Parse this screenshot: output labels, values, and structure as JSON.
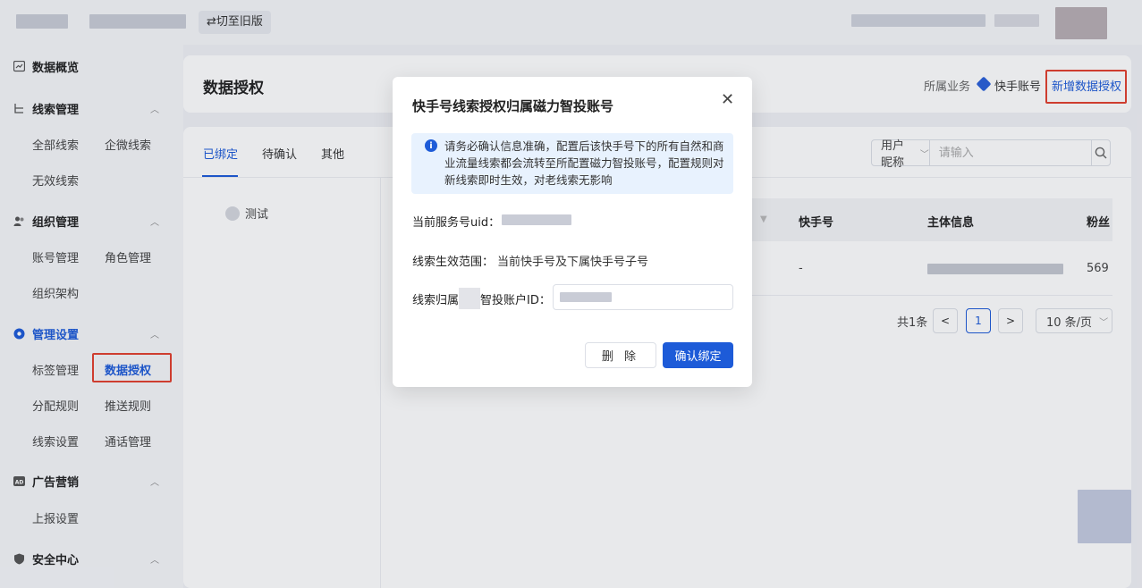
{
  "colors": {
    "accent": "#1d5bd8",
    "highlight": "#e2402e"
  },
  "topbar": {
    "switch_label": "⇄切至旧版"
  },
  "sidebar": {
    "groups": [
      {
        "label": "数据概览"
      },
      {
        "label": "线索管理",
        "items": [
          "全部线索",
          "企微线索",
          "无效线索"
        ]
      },
      {
        "label": "组织管理",
        "items": [
          "账号管理",
          "角色管理",
          "组织架构"
        ]
      },
      {
        "label": "管理设置",
        "items": [
          "标签管理",
          "数据授权",
          "分配规则",
          "推送规则",
          "线索设置",
          "通话管理"
        ]
      },
      {
        "label": "广告营销",
        "items": [
          "上报设置"
        ]
      },
      {
        "label": "安全中心"
      }
    ]
  },
  "header": {
    "title": "数据授权",
    "biz_label": "所属业务",
    "biz_account": "快手账号",
    "add_button": "新增数据授权"
  },
  "tabs": [
    "已绑定",
    "待确认",
    "其他"
  ],
  "left_list": {
    "item": "测试"
  },
  "filter": {
    "select": "用户昵称",
    "placeholder": "请输入"
  },
  "table": {
    "columns": [
      "快手号",
      "主体信息",
      "粉丝"
    ],
    "row": {
      "kuaishou": "-",
      "fans": "569"
    }
  },
  "pagination": {
    "total": "共1条",
    "current": "1",
    "page_size": "10 条/页"
  },
  "modal": {
    "title": "快手号线索授权归属磁力智投账号",
    "notice": "请务必确认信息准确，配置后该快手号下的所有自然和商业流量线索都会流转至所配置磁力智投账号，配置规则对新线索即时生效，对老线索无影响",
    "uid_label": "当前服务号uid：",
    "scope_label": "线索生效范围：",
    "scope_value": "当前快手号及下属快手号子号",
    "account_label_a": "线索归属",
    "account_label_b": "智投账户ID：",
    "delete_button": "删 除",
    "confirm_button": "确认绑定"
  }
}
